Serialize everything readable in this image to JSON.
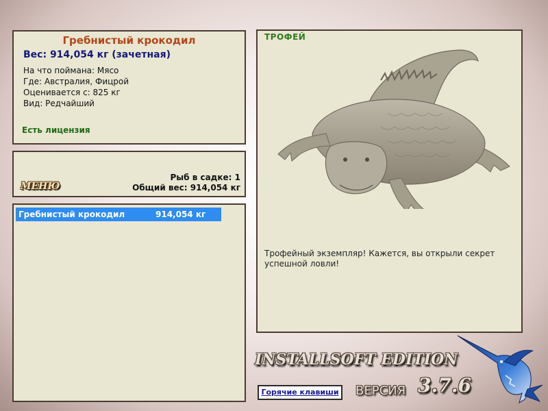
{
  "fish_card": {
    "name": "Гребнистый крокодил",
    "weight_line": "Вес: 914,054 кг (зачетная)",
    "caught_on": "На что поймана: Мясо",
    "location": "Где: Австралия, Фицрой",
    "valued_from": "Оценивается с: 825 кг",
    "rarity": "Вид: Редчайший",
    "license": "Есть лицензия"
  },
  "keepnet": {
    "menu_label": "МЕНЮ",
    "count_line": "Рыб в садке: 1",
    "total_line": "Общий вес: 914,054 кг"
  },
  "catch_list": [
    {
      "name": "Гребнистый крокодил",
      "weight": "914,054 кг",
      "selected": true
    }
  ],
  "trophy": {
    "label": "ТРОФЕЙ",
    "image": "saltwater-crocodile",
    "description": "Трофейный экземпляр! Кажется, вы открыли секрет успешной ловли!"
  },
  "footer": {
    "edition": "INSTALLSOFT EDITION",
    "version_label": "ВЕРСИЯ",
    "version_number": "3.7.6",
    "hotkeys_label": "Горячие клавиши",
    "logo": "marlin-logo"
  },
  "colors": {
    "panel_bg": "#e9e7d2",
    "panel_border": "#4b3b32",
    "fish_name": "#b4461a",
    "weight_text": "#141a78",
    "license_text": "#1f6a14",
    "trophy_label": "#2f7a1d",
    "selection": "#2f8cf0"
  }
}
